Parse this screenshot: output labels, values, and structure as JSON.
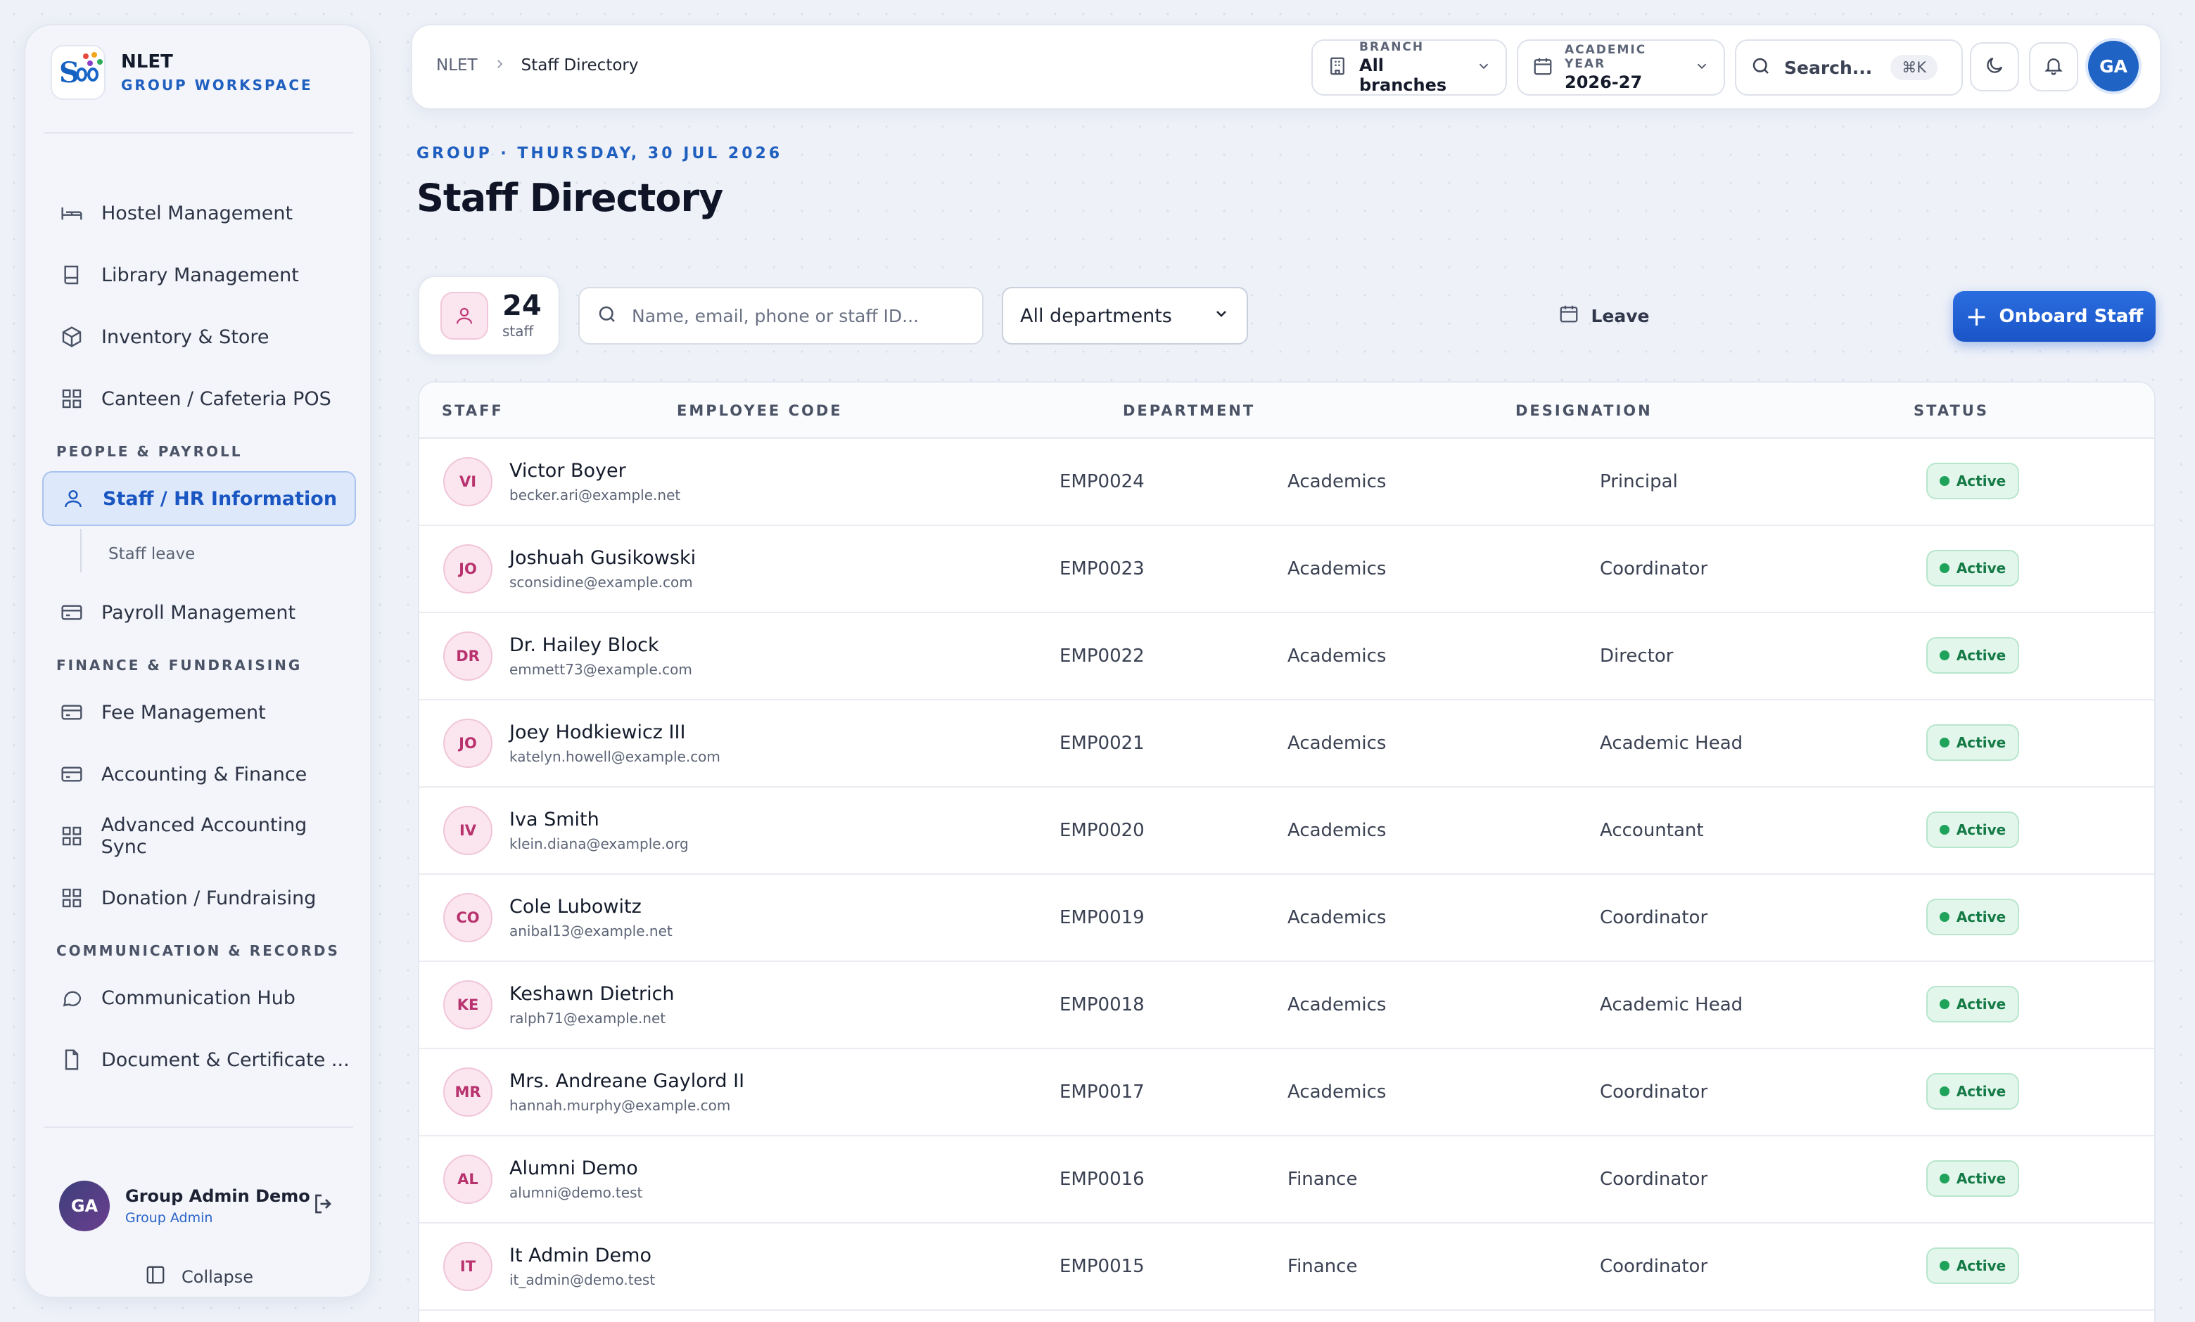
{
  "brand": {
    "name": "NLET",
    "subtitle": "GROUP WORKSPACE"
  },
  "sidebar": {
    "items_top": [
      {
        "label": "Hostel Management",
        "icon": "bed-icon"
      },
      {
        "label": "Library Management",
        "icon": "book-icon"
      },
      {
        "label": "Inventory & Store",
        "icon": "box-icon"
      },
      {
        "label": "Canteen / Cafeteria POS",
        "icon": "grid-icon"
      }
    ],
    "section_people": "PEOPLE & PAYROLL",
    "staff_hr": "Staff / HR Information",
    "staff_leave": "Staff leave",
    "payroll": "Payroll Management",
    "section_finance": "FINANCE & FUNDRAISING",
    "finance_items": [
      {
        "label": "Fee Management",
        "icon": "card-icon"
      },
      {
        "label": "Accounting & Finance",
        "icon": "card-icon"
      },
      {
        "label": "Advanced Accounting Sync",
        "icon": "grid-icon"
      },
      {
        "label": "Donation / Fundraising",
        "icon": "grid-icon"
      }
    ],
    "section_comm": "COMMUNICATION & RECORDS",
    "comm_items": [
      {
        "label": "Communication Hub",
        "icon": "chat-icon"
      },
      {
        "label": "Document & Certificate ...",
        "icon": "document-icon"
      }
    ],
    "user": {
      "initials": "GA",
      "name": "Group Admin Demo",
      "role": "Group Admin"
    },
    "collapse_label": "Collapse"
  },
  "topbar": {
    "breadcrumb_root": "NLET",
    "breadcrumb_current": "Staff Directory",
    "branch_label": "BRANCH",
    "branch_value": "All branches",
    "year_label": "ACADEMIC YEAR",
    "year_value": "2026-27",
    "search_label": "Search...",
    "search_shortcut": "⌘K",
    "avatar_initials": "GA"
  },
  "header": {
    "eyebrow": "GROUP · THURSDAY, 30 JUL 2026",
    "title": "Staff Directory"
  },
  "toolbar": {
    "count": "24",
    "count_label": "staff",
    "search_placeholder": "Name, email, phone or staff ID...",
    "department_selected": "All departments",
    "leave_label": "Leave",
    "onboard_label": "Onboard Staff"
  },
  "table": {
    "columns": [
      "STAFF",
      "EMPLOYEE CODE",
      "DEPARTMENT",
      "DESIGNATION",
      "STATUS"
    ],
    "rows": [
      {
        "initials": "VI",
        "name": "Victor Boyer",
        "email": "becker.ari@example.net",
        "code": "EMP0024",
        "department": "Academics",
        "designation": "Principal",
        "status": "Active"
      },
      {
        "initials": "JO",
        "name": "Joshuah Gusikowski",
        "email": "sconsidine@example.com",
        "code": "EMP0023",
        "department": "Academics",
        "designation": "Coordinator",
        "status": "Active"
      },
      {
        "initials": "DR",
        "name": "Dr. Hailey Block",
        "email": "emmett73@example.com",
        "code": "EMP0022",
        "department": "Academics",
        "designation": "Director",
        "status": "Active"
      },
      {
        "initials": "JO",
        "name": "Joey Hodkiewicz III",
        "email": "katelyn.howell@example.com",
        "code": "EMP0021",
        "department": "Academics",
        "designation": "Academic Head",
        "status": "Active"
      },
      {
        "initials": "IV",
        "name": "Iva Smith",
        "email": "klein.diana@example.org",
        "code": "EMP0020",
        "department": "Academics",
        "designation": "Accountant",
        "status": "Active"
      },
      {
        "initials": "CO",
        "name": "Cole Lubowitz",
        "email": "anibal13@example.net",
        "code": "EMP0019",
        "department": "Academics",
        "designation": "Coordinator",
        "status": "Active"
      },
      {
        "initials": "KE",
        "name": "Keshawn Dietrich",
        "email": "ralph71@example.net",
        "code": "EMP0018",
        "department": "Academics",
        "designation": "Academic Head",
        "status": "Active"
      },
      {
        "initials": "MR",
        "name": "Mrs. Andreane Gaylord II",
        "email": "hannah.murphy@example.com",
        "code": "EMP0017",
        "department": "Academics",
        "designation": "Coordinator",
        "status": "Active"
      },
      {
        "initials": "AL",
        "name": "Alumni Demo",
        "email": "alumni@demo.test",
        "code": "EMP0016",
        "department": "Finance",
        "designation": "Coordinator",
        "status": "Active"
      },
      {
        "initials": "IT",
        "name": "It Admin Demo",
        "email": "it_admin@demo.test",
        "code": "EMP0015",
        "department": "Finance",
        "designation": "Coordinator",
        "status": "Active"
      }
    ]
  },
  "colors": {
    "accent": "#1f5fbf",
    "active_status": "#147a45",
    "avatar_pink": "#b8326e"
  }
}
